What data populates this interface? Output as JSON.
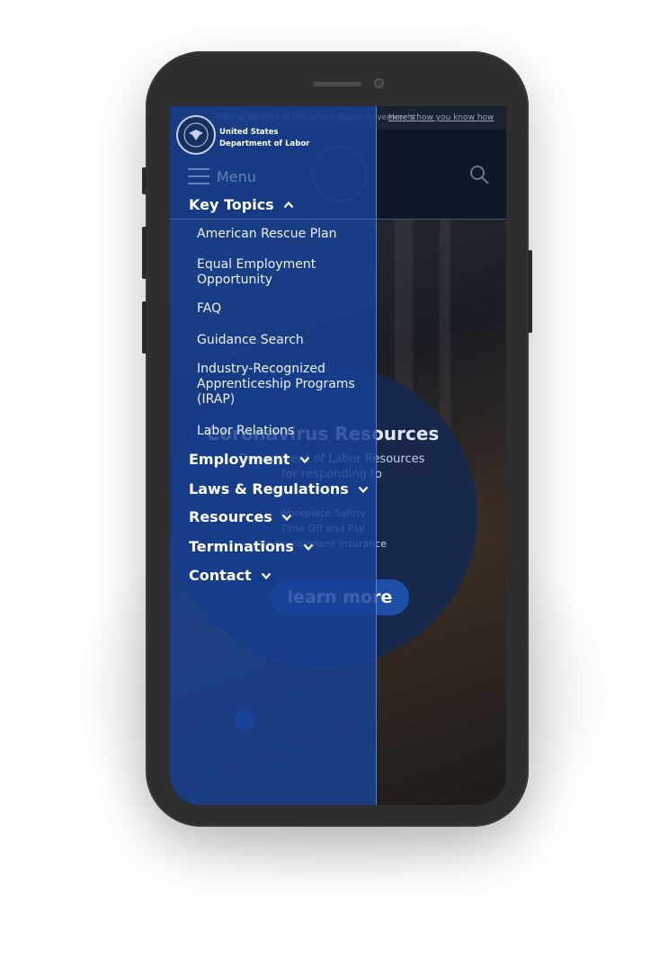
{
  "gov_banner": {
    "text": "Official Website of the United States Government",
    "link": "Here's how you know how"
  },
  "agency": {
    "line1": "United States",
    "line2": "Department of Labor"
  },
  "menu_label": "Menu",
  "nav": {
    "key_topics": {
      "label": "Key Topics",
      "expanded": true,
      "items": [
        "American Rescue Plan",
        "Equal Employment Opportunity",
        "FAQ",
        "Guidance Search",
        "Industry-Recognized Apprenticeship Programs (IRAP)",
        "Labor Relations"
      ]
    },
    "collapsed": [
      "Employment",
      "Laws & Regulations",
      "Resources",
      "Terminations",
      "Contact"
    ]
  },
  "hero": {
    "title": "Coronavirus Resources",
    "description": "Department of Labor Resources for responding to",
    "list": [
      "Workplace Safety",
      "Time Off and Pay",
      "Unemployment Insurance"
    ],
    "button": "learn more"
  },
  "colors": {
    "drawer": "#1842a0",
    "header": "#0f1826",
    "accent": "#1d4fa8"
  },
  "icons": [
    "search-icon",
    "hamburger-icon",
    "chevron-up-icon",
    "chevron-down-icon",
    "seal-icon"
  ]
}
